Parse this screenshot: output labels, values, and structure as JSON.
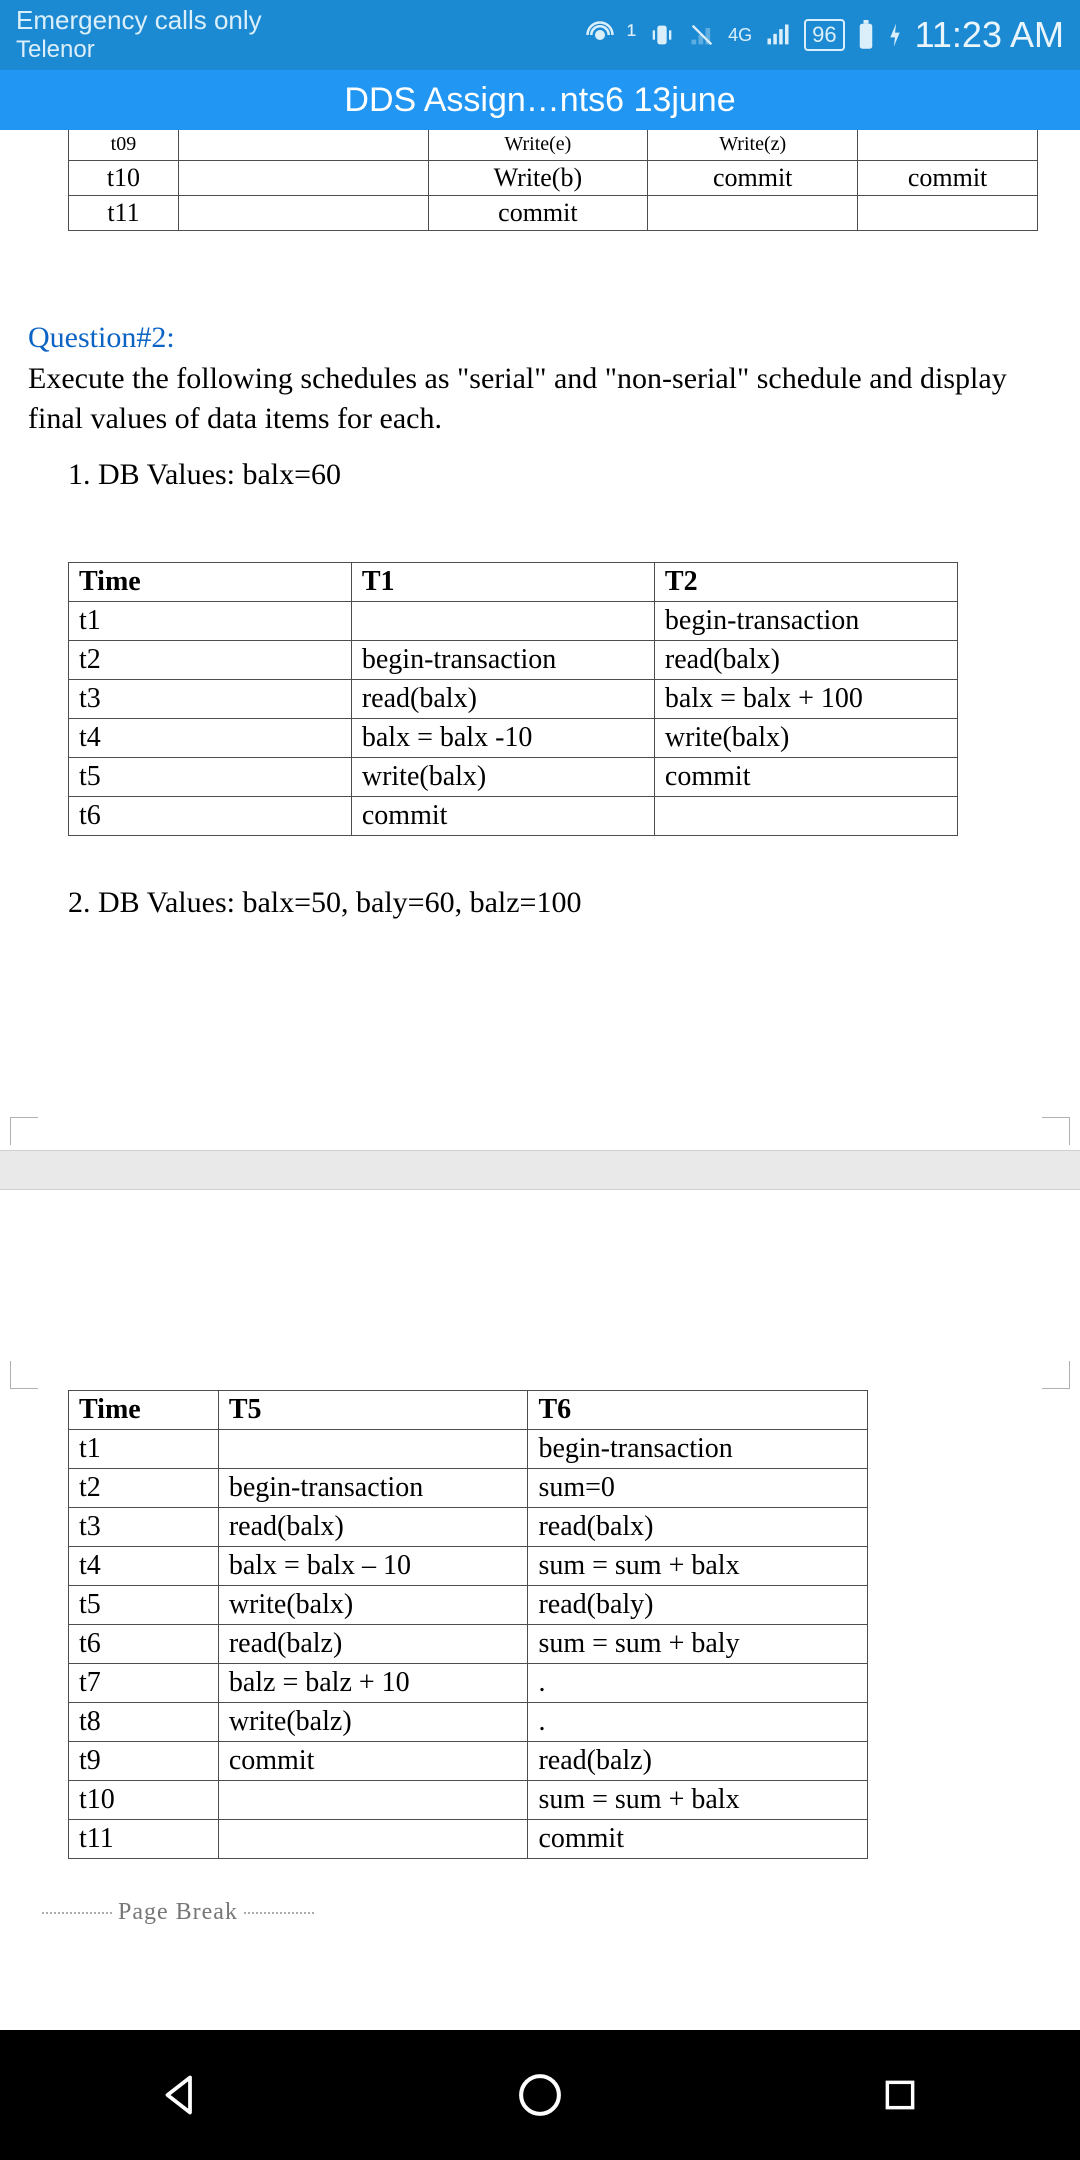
{
  "status": {
    "line1": "Emergency calls only",
    "line2": "Telenor",
    "net_label": "4G",
    "battery": "96",
    "time": "11:23 AM"
  },
  "title": "DDS Assign…nts6 13june",
  "partial_table": {
    "rows": [
      {
        "t": "t09",
        "c2": "Write(e)",
        "c3": "Write(z)",
        "c4": ""
      },
      {
        "t": "t10",
        "c2": "Write(b)",
        "c3": "commit",
        "c4": "commit"
      },
      {
        "t": "t11",
        "c2": "commit",
        "c3": "",
        "c4": ""
      }
    ]
  },
  "q2": {
    "title": "Question#2:",
    "body": "Execute the following schedules as \"serial\" and \"non-serial\" schedule and display final values of data items for each.",
    "item1": "1.  DB Values: balx=60",
    "item2": "2.  DB Values: balx=50, baly=60, balz=100"
  },
  "table1": {
    "headers": [
      "Time",
      "T1",
      "T2"
    ],
    "rows": [
      [
        "t1",
        "",
        "begin-transaction"
      ],
      [
        "t2",
        "begin-transaction",
        "read(balx)"
      ],
      [
        "t3",
        "read(balx)",
        "balx = balx + 100"
      ],
      [
        "t4",
        "balx = balx -10",
        "write(balx)"
      ],
      [
        "t5",
        "write(balx)",
        "commit"
      ],
      [
        "t6",
        "commit",
        ""
      ]
    ]
  },
  "table2": {
    "headers": [
      "Time",
      "T5",
      "T6"
    ],
    "rows": [
      [
        "t1",
        "",
        "begin-transaction"
      ],
      [
        "t2",
        "begin-transaction",
        "sum=0"
      ],
      [
        "t3",
        "read(balx)",
        "read(balx)"
      ],
      [
        "t4",
        "balx = balx – 10",
        "sum = sum + balx"
      ],
      [
        "t5",
        "write(balx)",
        "read(baly)"
      ],
      [
        "t6",
        "read(balz)",
        "sum = sum + baly"
      ],
      [
        "t7",
        "balz = balz + 10",
        "."
      ],
      [
        "t8",
        "write(balz)",
        "."
      ],
      [
        "t9",
        "commit",
        "read(balz)"
      ],
      [
        "t10",
        "",
        "sum = sum + balx"
      ],
      [
        "t11",
        "",
        "commit"
      ]
    ]
  },
  "page_break": "Page Break",
  "nav": {
    "back": "back",
    "home": "home",
    "recent": "recent"
  }
}
